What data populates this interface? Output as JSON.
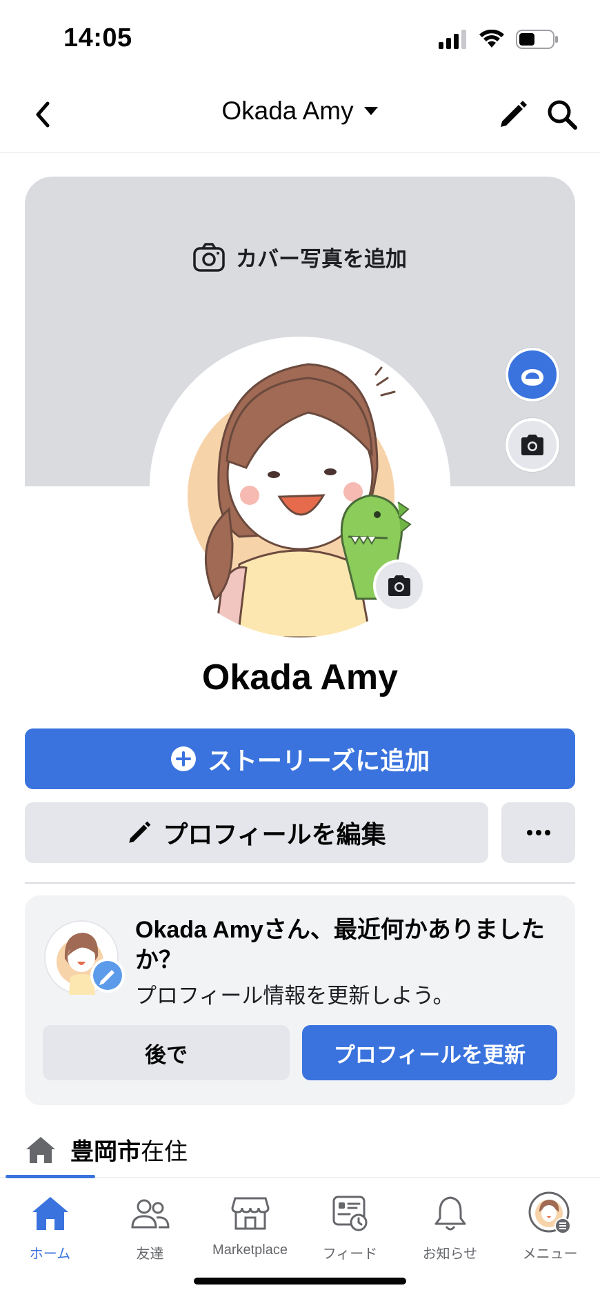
{
  "status_bar": {
    "time": "14:05"
  },
  "nav": {
    "title": "Okada Amy"
  },
  "cover": {
    "add_cover_label": "カバー写真を追加"
  },
  "profile": {
    "name": "Okada Amy"
  },
  "actions": {
    "add_story_label": "ストーリーズに追加",
    "edit_profile_label": "プロフィールを編集",
    "more_label": "•••"
  },
  "prompt": {
    "title": "Okada Amyさん、最近何かありましたか？",
    "subtitle": "プロフィール情報を更新しよう。",
    "later_label": "後で",
    "update_label": "プロフィールを更新"
  },
  "lives_in": {
    "city": "豊岡市",
    "suffix": "在住"
  },
  "tabs": [
    {
      "label": "ホーム",
      "icon": "home-icon",
      "active": true
    },
    {
      "label": "友達",
      "icon": "friends-icon",
      "active": false
    },
    {
      "label": "Marketplace",
      "icon": "marketplace-icon",
      "active": false
    },
    {
      "label": "フィード",
      "icon": "feed-icon",
      "active": false
    },
    {
      "label": "お知らせ",
      "icon": "bell-icon",
      "active": false
    },
    {
      "label": "メニュー",
      "icon": "menu-avatar-icon",
      "active": false
    }
  ],
  "colors": {
    "accent": "#3a73de",
    "secondary_button": "#e4e6eb",
    "cover": "#d9dbdf"
  }
}
